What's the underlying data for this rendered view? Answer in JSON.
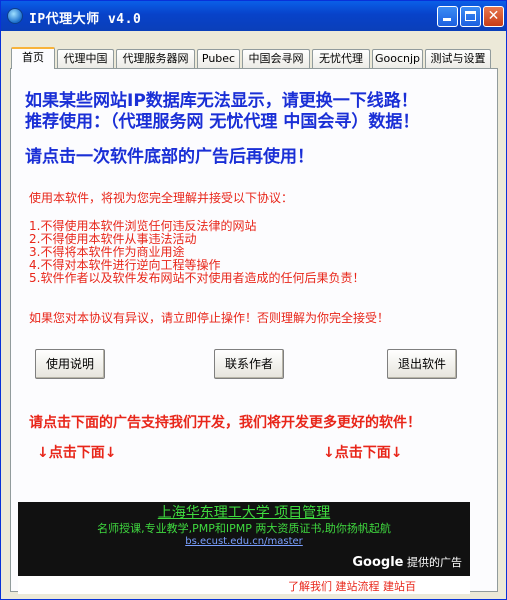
{
  "window": {
    "title": "IP代理大师 v4.0"
  },
  "tabs": [
    {
      "label": "首页"
    },
    {
      "label": "代理中国"
    },
    {
      "label": "代理服务器网"
    },
    {
      "label": "Pubec"
    },
    {
      "label": "中国会寻网"
    },
    {
      "label": "无忧代理"
    },
    {
      "label": "Goocnjp"
    },
    {
      "label": "测试与设置"
    }
  ],
  "notice": {
    "line1": "如果某些网站IP数据库无法显示，请更换一下线路！",
    "line2": "推荐使用：（代理服务网 无忧代理 中国会寻）数据！",
    "line3": "请点击一次软件底部的广告后再使用！"
  },
  "agreement": {
    "intro": "使用本软件，将视为您完全理解并接受以下协议：",
    "items": [
      "1.不得使用本软件浏览任何违反法律的网站",
      "2.不得使用本软件从事违法活动",
      "3.不得将本软件作为商业用途",
      "4.不得对本软件进行逆向工程等操作",
      "5.软件作者以及软件发布网站不对使用者造成的任何后果负责！"
    ],
    "outro": "如果您对本协议有异议，请立即停止操作！否则理解为你完全接受！"
  },
  "buttons": {
    "help": "使用说明",
    "contact": "联系作者",
    "exit": "退出软件"
  },
  "promo": "请点击下面的广告支持我们开发，我们将开发更多更好的软件！",
  "click_left": "↓点击下面↓",
  "click_right": "↓点击下面↓",
  "ad": {
    "title": "上海华东理工大学 项目管理",
    "desc": "名师授课,专业教学,PMP和IPMP 两大资质证书,助你扬帆起航",
    "url": "bs.ecust.edu.cn/master",
    "google_brand": "Google",
    "google_suffix": "提供的广告",
    "bottom": "了解我们    建站流程    建站百"
  },
  "colors": {
    "title_blue": "#0842c9",
    "text_blue": "#1a2fd6",
    "text_red": "#e8261a",
    "ad_green": "#3fd93f"
  }
}
